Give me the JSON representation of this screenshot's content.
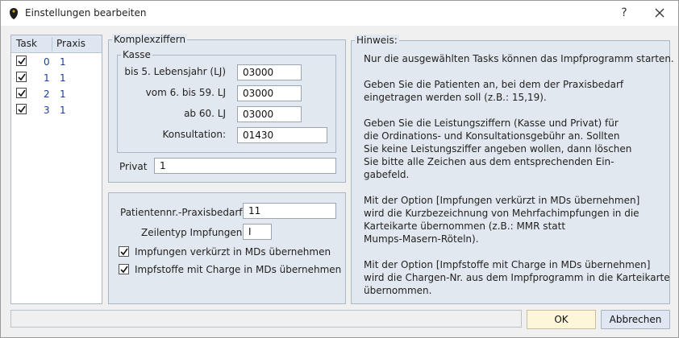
{
  "window": {
    "title": "Einstellungen bearbeiten",
    "help_glyph": "?",
    "close_icon": "close-icon"
  },
  "tasks": {
    "col_task": "Task",
    "col_praxis": "Praxis",
    "rows": [
      {
        "task": "0",
        "praxis": "1",
        "checked": true
      },
      {
        "task": "1",
        "praxis": "1",
        "checked": true
      },
      {
        "task": "2",
        "praxis": "1",
        "checked": true
      },
      {
        "task": "3",
        "praxis": "1",
        "checked": true
      }
    ]
  },
  "komplexziffern": {
    "group_label": "Komplexziffern",
    "kasse_label": "Kasse",
    "fields": [
      {
        "label": "bis 5. Lebensjahr (LJ)",
        "value": "03000"
      },
      {
        "label": "vom 6. bis 59. LJ",
        "value": "03000"
      },
      {
        "label": "ab 60. LJ",
        "value": "03000"
      },
      {
        "label": "Konsultation:",
        "value": "01430"
      }
    ],
    "privat_label": "Privat",
    "privat_value": "1"
  },
  "options": {
    "patientennr_label": "Patientennr.-Praxisbedarf",
    "patientennr_value": "11",
    "zeilentyp_label": "Zeilentyp Impfungen",
    "zeilentyp_value": "I",
    "check1_label": "Impfungen verkürzt in MDs übernehmen",
    "check1_checked": true,
    "check2_label": "Impfstoffe mit Charge in MDs übernehmen",
    "check2_checked": true
  },
  "hinweis": {
    "label": "Hinweis:",
    "lines": [
      "Nur die ausgewählten Tasks können das Impfprogramm starten.",
      "Geben Sie die Patienten an, bei dem der Praxisbedarf",
      "eingetragen werden soll (z.B.: 15,19).",
      "Geben Sie die Leistungsziffern (Kasse und Privat) für",
      "die Ordinations- und Konsultationsgebühr an. Sollten",
      "Sie keine Leistungsziffer angeben wollen, dann löschen",
      "Sie bitte alle Zeichen aus dem entsprechenden Ein-",
      "gabefeld.",
      "Mit der Option [Impfungen verkürzt in MDs übernehmen]",
      "wird die Kurzbezeichnung von Mehrfachimpfungen in die",
      "Karteikarte übernommen (z.B.: MMR statt",
      "Mumps-Masern-Röteln).",
      "Mit der Option [Impfstoffe mit Charge in MDs übernehmen]",
      "wird die Chargen-Nr. aus dem Impfprogramm in die Karteikarte",
      "übernommen."
    ]
  },
  "buttons": {
    "ok": "OK",
    "cancel": "Abbrechen"
  }
}
